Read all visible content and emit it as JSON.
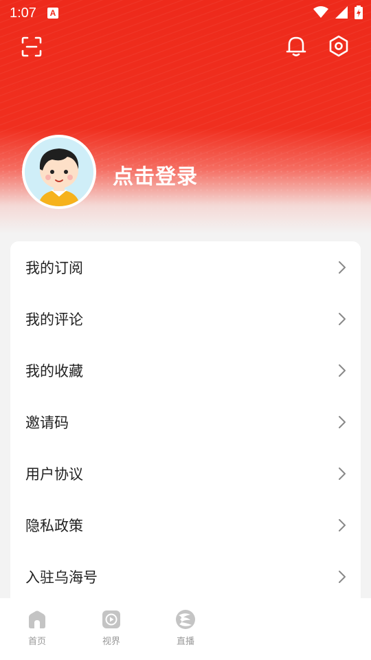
{
  "status_bar": {
    "time": "1:07",
    "app_icon_letter": "A",
    "icons": [
      "wifi-icon",
      "signal-icon",
      "battery-icon"
    ]
  },
  "header": {
    "login_text": "点击登录",
    "icons": [
      "scan-icon",
      "bell-icon",
      "settings-icon"
    ]
  },
  "menu": {
    "items": [
      {
        "label": "我的订阅"
      },
      {
        "label": "我的评论"
      },
      {
        "label": "我的收藏"
      },
      {
        "label": "邀请码"
      },
      {
        "label": "用户协议"
      },
      {
        "label": "隐私政策"
      },
      {
        "label": "入驻乌海号"
      }
    ]
  },
  "tabbar": {
    "items": [
      {
        "label": "首页",
        "icon": "home-icon"
      },
      {
        "label": "视界",
        "icon": "video-icon"
      },
      {
        "label": "直播",
        "icon": "live-logo-icon"
      }
    ]
  },
  "colors": {
    "brand_red": "#ee2a1b",
    "menu_text": "#222222",
    "tab_text": "#999999",
    "chevron": "#888888"
  }
}
